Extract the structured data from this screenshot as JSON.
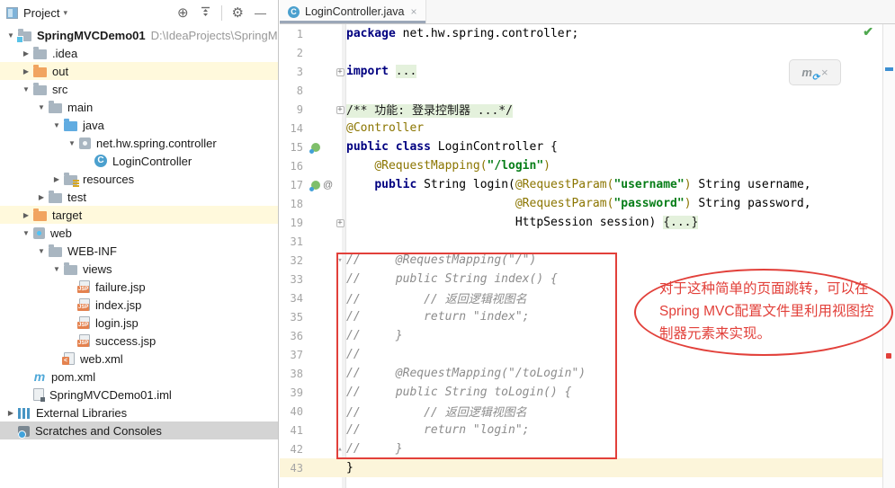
{
  "icons": {
    "expanded": "▼",
    "collapsed": "▶",
    "fold_box": "+",
    "fold_open": "▾",
    "fold_close": "▴",
    "gear": "⚙",
    "locate": "⊕",
    "minimize": "—",
    "caret_down": "▾",
    "close": "×",
    "check": "✔",
    "at": "@",
    "class_letter": "C",
    "maven_letter": "m",
    "refresh": "⟳"
  },
  "project_panel": {
    "header": {
      "title": "Project"
    },
    "tree": [
      {
        "label": "SpringMVCDemo01",
        "path": "D:\\IdeaProjects\\SpringM",
        "level": 0,
        "state": "expanded",
        "icon": "module-folder",
        "bold": true
      },
      {
        "label": ".idea",
        "level": 1,
        "state": "collapsed",
        "icon": "folder"
      },
      {
        "label": "out",
        "level": 1,
        "state": "collapsed",
        "icon": "excluded-folder",
        "highlight": "cream"
      },
      {
        "label": "src",
        "level": 1,
        "state": "expanded",
        "icon": "folder"
      },
      {
        "label": "main",
        "level": 2,
        "state": "expanded",
        "icon": "folder"
      },
      {
        "label": "java",
        "level": 3,
        "state": "expanded",
        "icon": "source-folder"
      },
      {
        "label": "net.hw.spring.controller",
        "level": 4,
        "state": "expanded",
        "icon": "package"
      },
      {
        "label": "LoginController",
        "level": 5,
        "state": null,
        "icon": "class"
      },
      {
        "label": "resources",
        "level": 3,
        "state": "collapsed",
        "icon": "resources-folder"
      },
      {
        "label": "test",
        "level": 2,
        "state": "collapsed",
        "icon": "folder"
      },
      {
        "label": "target",
        "level": 1,
        "state": "collapsed",
        "icon": "excluded-folder",
        "highlight": "cream"
      },
      {
        "label": "web",
        "level": 1,
        "state": "expanded",
        "icon": "web-folder"
      },
      {
        "label": "WEB-INF",
        "level": 2,
        "state": "expanded",
        "icon": "folder"
      },
      {
        "label": "views",
        "level": 3,
        "state": "expanded",
        "icon": "folder"
      },
      {
        "label": "failure.jsp",
        "level": 4,
        "state": null,
        "icon": "jsp-file"
      },
      {
        "label": "index.jsp",
        "level": 4,
        "state": null,
        "icon": "jsp-file"
      },
      {
        "label": "login.jsp",
        "level": 4,
        "state": null,
        "icon": "jsp-file"
      },
      {
        "label": "success.jsp",
        "level": 4,
        "state": null,
        "icon": "jsp-file"
      },
      {
        "label": "web.xml",
        "level": 3,
        "state": null,
        "icon": "xml-file"
      },
      {
        "label": "pom.xml",
        "level": 1,
        "state": null,
        "icon": "maven"
      },
      {
        "label": "SpringMVCDemo01.iml",
        "level": 1,
        "state": null,
        "icon": "iml-file"
      },
      {
        "label": "External Libraries",
        "level": 0,
        "state": "collapsed",
        "icon": "libraries"
      },
      {
        "label": "Scratches and Consoles",
        "level": 0,
        "state": null,
        "icon": "scratches",
        "highlight": "selected"
      }
    ]
  },
  "editor": {
    "tab": {
      "title": "LoginController.java"
    },
    "lines": [
      {
        "num": 1,
        "seg": [
          [
            "kw",
            "package"
          ],
          [
            "pl",
            " net.hw.spring.controller;"
          ]
        ]
      },
      {
        "num": 2,
        "seg": []
      },
      {
        "num": 3,
        "seg": [
          [
            "kw",
            "import"
          ],
          [
            "pl",
            " "
          ],
          [
            "fold",
            "..."
          ]
        ],
        "fold": "box"
      },
      {
        "num": 8,
        "seg": []
      },
      {
        "num": 9,
        "seg": [
          [
            "fold",
            "/** 功能: 登录控制器 ...*/"
          ]
        ],
        "fold": "box"
      },
      {
        "num": 14,
        "seg": [
          [
            "ann",
            "@Controller"
          ]
        ]
      },
      {
        "num": 15,
        "seg": [
          [
            "kw",
            "public class"
          ],
          [
            "pl",
            " LoginController {"
          ]
        ],
        "g": [
          "spring"
        ]
      },
      {
        "num": 16,
        "seg": [
          [
            "pl",
            "    "
          ],
          [
            "ann",
            "@RequestMapping("
          ],
          [
            "str",
            "\"/login\""
          ],
          [
            "ann",
            ")"
          ]
        ]
      },
      {
        "num": 17,
        "seg": [
          [
            "pl",
            "    "
          ],
          [
            "kw",
            "public"
          ],
          [
            "pl",
            " String login("
          ],
          [
            "ann",
            "@RequestParam("
          ],
          [
            "str",
            "\"username\""
          ],
          [
            "ann",
            ")"
          ],
          [
            "pl",
            " String username,"
          ]
        ],
        "g": [
          "spring",
          "at"
        ]
      },
      {
        "num": 18,
        "seg": [
          [
            "pl",
            "                        "
          ],
          [
            "ann",
            "@RequestParam("
          ],
          [
            "str",
            "\"password\""
          ],
          [
            "ann",
            ")"
          ],
          [
            "pl",
            " String password,"
          ]
        ]
      },
      {
        "num": 19,
        "seg": [
          [
            "pl",
            "                        HttpSession session) "
          ],
          [
            "fold",
            "{...}"
          ]
        ],
        "fold": "box"
      },
      {
        "num": 31,
        "seg": []
      },
      {
        "num": 32,
        "seg": [
          [
            "cmt",
            "//     @RequestMapping(\"/\")"
          ]
        ],
        "fold": "open"
      },
      {
        "num": 33,
        "seg": [
          [
            "cmt",
            "//     public String index() {"
          ]
        ]
      },
      {
        "num": 34,
        "seg": [
          [
            "cmt",
            "//         // 返回逻辑视图名"
          ]
        ]
      },
      {
        "num": 35,
        "seg": [
          [
            "cmt",
            "//         return \"index\";"
          ]
        ]
      },
      {
        "num": 36,
        "seg": [
          [
            "cmt",
            "//     }"
          ]
        ]
      },
      {
        "num": 37,
        "seg": [
          [
            "cmt",
            "//"
          ]
        ]
      },
      {
        "num": 38,
        "seg": [
          [
            "cmt",
            "//     @RequestMapping(\"/toLogin\")"
          ]
        ]
      },
      {
        "num": 39,
        "seg": [
          [
            "cmt",
            "//     public String toLogin() {"
          ]
        ]
      },
      {
        "num": 40,
        "seg": [
          [
            "cmt",
            "//         // 返回逻辑视图名"
          ]
        ]
      },
      {
        "num": 41,
        "seg": [
          [
            "cmt",
            "//         return \"login\";"
          ]
        ]
      },
      {
        "num": 42,
        "seg": [
          [
            "cmt",
            "//     }"
          ]
        ],
        "fold": "close"
      },
      {
        "num": 43,
        "seg": [
          [
            "pl",
            "}"
          ]
        ],
        "caret": true
      }
    ]
  },
  "annotation": {
    "color": "#E2403A",
    "lines": [
      "对于这种简单的页面跳转，可以在",
      "Spring MVC配置文件里利用视图控",
      "制器元素来实现。"
    ]
  }
}
